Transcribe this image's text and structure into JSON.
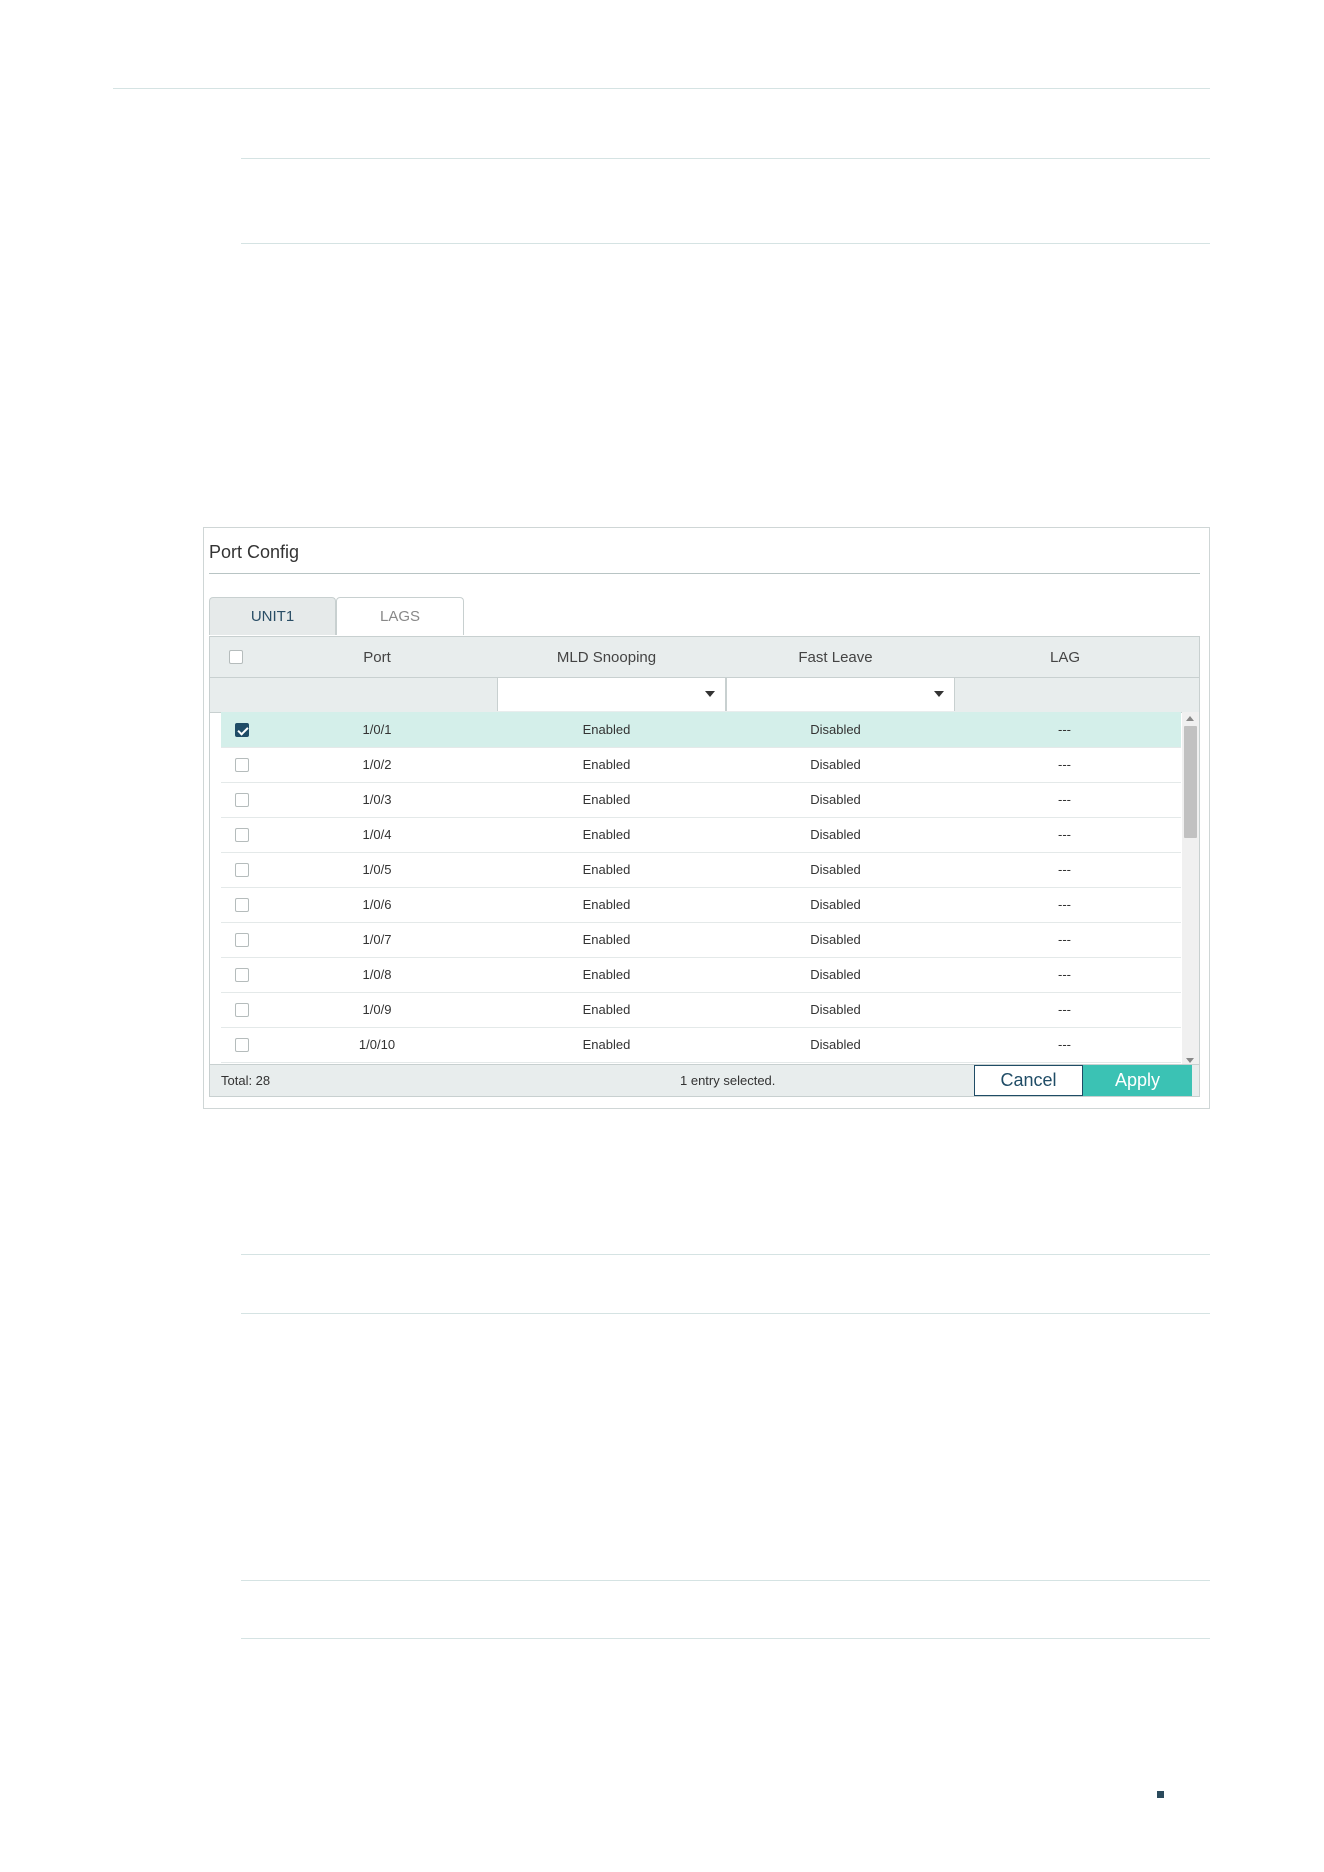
{
  "panel": {
    "title": "Port Config",
    "tabs": [
      {
        "label": "UNIT1",
        "active": true
      },
      {
        "label": "LAGS",
        "active": false
      }
    ],
    "columns": [
      "Port",
      "MLD Snooping",
      "Fast Leave",
      "LAG"
    ],
    "rows": [
      {
        "checked": true,
        "port": "1/0/1",
        "mld": "Enabled",
        "fast": "Disabled",
        "lag": "---"
      },
      {
        "checked": false,
        "port": "1/0/2",
        "mld": "Enabled",
        "fast": "Disabled",
        "lag": "---"
      },
      {
        "checked": false,
        "port": "1/0/3",
        "mld": "Enabled",
        "fast": "Disabled",
        "lag": "---"
      },
      {
        "checked": false,
        "port": "1/0/4",
        "mld": "Enabled",
        "fast": "Disabled",
        "lag": "---"
      },
      {
        "checked": false,
        "port": "1/0/5",
        "mld": "Enabled",
        "fast": "Disabled",
        "lag": "---"
      },
      {
        "checked": false,
        "port": "1/0/6",
        "mld": "Enabled",
        "fast": "Disabled",
        "lag": "---"
      },
      {
        "checked": false,
        "port": "1/0/7",
        "mld": "Enabled",
        "fast": "Disabled",
        "lag": "---"
      },
      {
        "checked": false,
        "port": "1/0/8",
        "mld": "Enabled",
        "fast": "Disabled",
        "lag": "---"
      },
      {
        "checked": false,
        "port": "1/0/9",
        "mld": "Enabled",
        "fast": "Disabled",
        "lag": "---"
      },
      {
        "checked": false,
        "port": "1/0/10",
        "mld": "Enabled",
        "fast": "Disabled",
        "lag": "---"
      }
    ],
    "footer": {
      "total": "Total: 28",
      "selected": "1 entry selected.",
      "cancel": "Cancel",
      "apply": "Apply"
    }
  },
  "colors": {
    "accent": "#3bc2b4",
    "dark": "#1f4c66",
    "selected_row": "#d4efea"
  }
}
